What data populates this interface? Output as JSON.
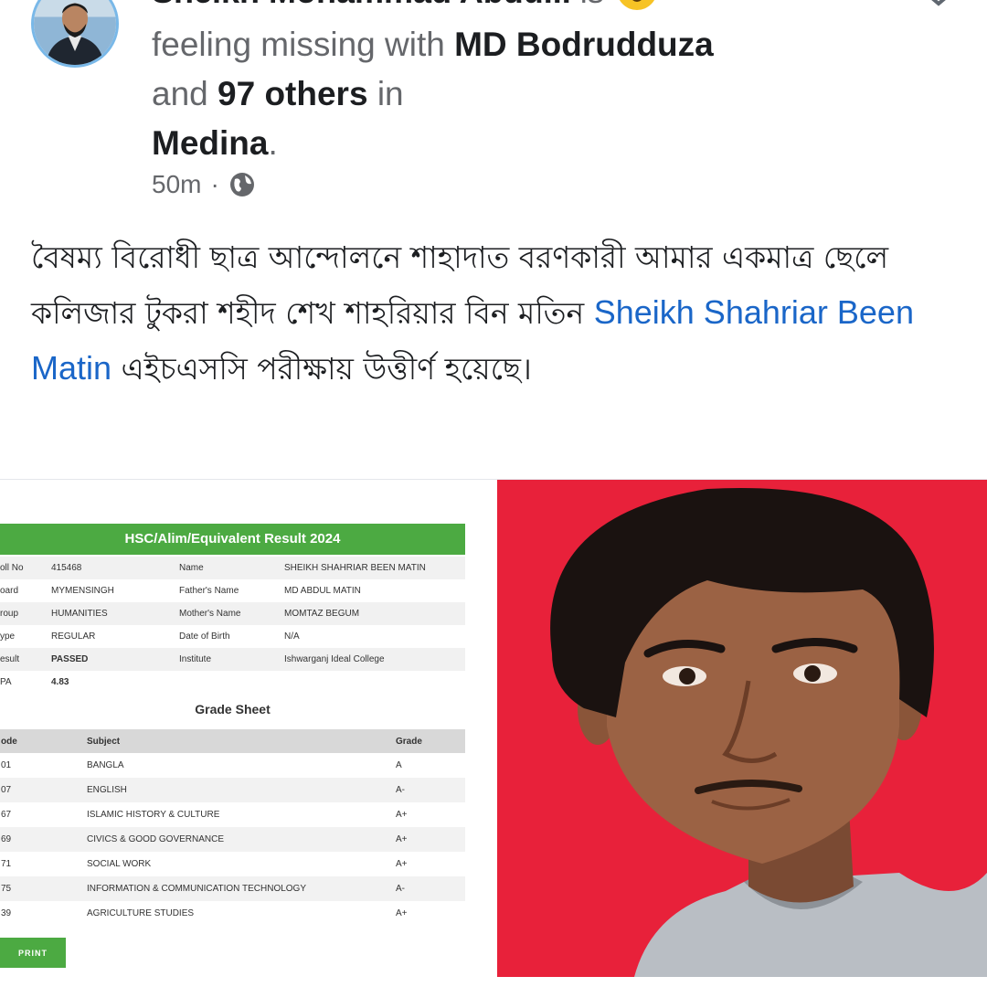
{
  "post": {
    "author_name": "Sheikh Mohammad Abdu...",
    "is_word": "is",
    "feeling_prefix": "feeling missing with",
    "tagged_person": "MD Bodrudduza",
    "and_word": "and",
    "others": "97 others",
    "in_word": "in",
    "location": "Medina",
    "period": ".",
    "time": "50m",
    "dot": "·",
    "body_text": "বৈষম্য বিরোধী ছাত্র আন্দোলনে শাহাদাত বরণকারী আমার একমাত্র ছেলে কলিজার টুকরা শহীদ শেখ শাহরিয়ার বিন মতিন",
    "mention": "Sheikh Shahriar Been Matin",
    "body_text_end": "এইচএসসি পরীক্ষায় উত্তীর্ণ হয়েছে।"
  },
  "result": {
    "title": "HSC/Alim/Equivalent Result 2024",
    "info_rows": [
      {
        "l1": "oll No",
        "v1": "415468",
        "l2": "Name",
        "v2": "SHEIKH SHAHRIAR BEEN MATIN"
      },
      {
        "l1": "oard",
        "v1": "MYMENSINGH",
        "l2": "Father's Name",
        "v2": "MD ABDUL MATIN"
      },
      {
        "l1": "roup",
        "v1": "HUMANITIES",
        "l2": "Mother's Name",
        "v2": "MOMTAZ BEGUM"
      },
      {
        "l1": "ype",
        "v1": "REGULAR",
        "l2": "Date of Birth",
        "v2": "N/A"
      },
      {
        "l1": "esult",
        "v1": "PASSED",
        "l2": "Institute",
        "v2": "Ishwarganj Ideal College"
      },
      {
        "l1": "PA",
        "v1": "4.83",
        "l2": "",
        "v2": ""
      }
    ],
    "grade_heading": "Grade Sheet",
    "grade_columns": [
      "ode",
      "Subject",
      "Grade"
    ],
    "grades": [
      {
        "code": "01",
        "subject": "BANGLA",
        "grade": "A"
      },
      {
        "code": "07",
        "subject": "ENGLISH",
        "grade": "A-"
      },
      {
        "code": "67",
        "subject": "ISLAMIC HISTORY & CULTURE",
        "grade": "A+"
      },
      {
        "code": "69",
        "subject": "CIVICS & GOOD GOVERNANCE",
        "grade": "A+"
      },
      {
        "code": "71",
        "subject": "SOCIAL WORK",
        "grade": "A+"
      },
      {
        "code": "75",
        "subject": "INFORMATION & COMMUNICATION TECHNOLOGY",
        "grade": "A-"
      },
      {
        "code": "39",
        "subject": "AGRICULTURE STUDIES",
        "grade": "A+"
      }
    ],
    "print_label": "PRINT"
  },
  "icons": {
    "emoji": "astonished-face-icon",
    "globe": "globe-icon",
    "close": "close-icon"
  },
  "colors": {
    "link": "#1a66c8",
    "result_green": "#4caa42",
    "photo_background": "#e8213a"
  }
}
